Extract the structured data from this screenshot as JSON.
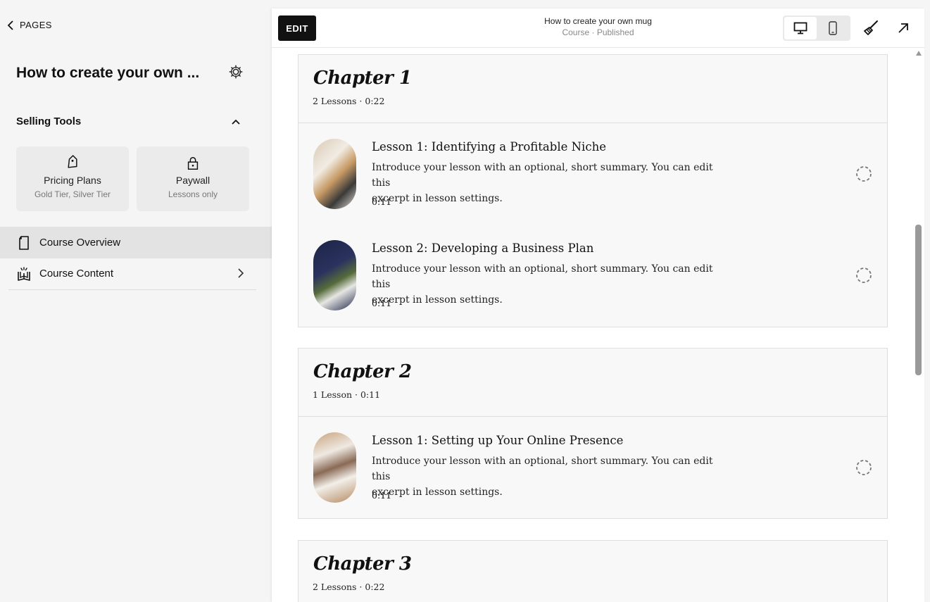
{
  "sidebar": {
    "back_label": "PAGES",
    "page_title": "How to create your own ...",
    "selling_tools_label": "Selling Tools",
    "cards": [
      {
        "title": "Pricing Plans",
        "subtitle": "Gold Tier, Silver Tier",
        "icon": "tag-icon"
      },
      {
        "title": "Paywall",
        "subtitle": "Lessons only",
        "icon": "lock-icon"
      }
    ],
    "nav": [
      {
        "label": "Course Overview",
        "icon": "page-icon",
        "active": true
      },
      {
        "label": "Course Content",
        "icon": "open-book-icon",
        "active": false
      }
    ]
  },
  "topbar": {
    "edit_label": "EDIT",
    "title": "How to create your own mug",
    "subtitle": "Course · Published"
  },
  "chapters": [
    {
      "title": "Chapter 1",
      "meta": "2 Lessons · 0:22",
      "lessons": [
        {
          "title": "Lesson 1: Identifying a Profitable Niche",
          "desc_line1": "Introduce your lesson with an optional, short summary. You can edit this",
          "desc_line2": "excerpt in lesson settings.",
          "duration": "0:11"
        },
        {
          "title": "Lesson 2: Developing a Business Plan",
          "desc_line1": "Introduce your lesson with an optional, short summary. You can edit this",
          "desc_line2": "excerpt in lesson settings.",
          "duration": "0:11"
        }
      ]
    },
    {
      "title": "Chapter 2",
      "meta": "1 Lesson · 0:11",
      "lessons": [
        {
          "title": "Lesson 1: Setting up Your Online Presence",
          "desc_line1": "Introduce your lesson with an optional, short summary. You can edit this",
          "desc_line2": "excerpt in lesson settings.",
          "duration": "0:11"
        }
      ]
    },
    {
      "title": "Chapter 3",
      "meta": "2 Lessons · 0:22",
      "lessons": []
    }
  ]
}
